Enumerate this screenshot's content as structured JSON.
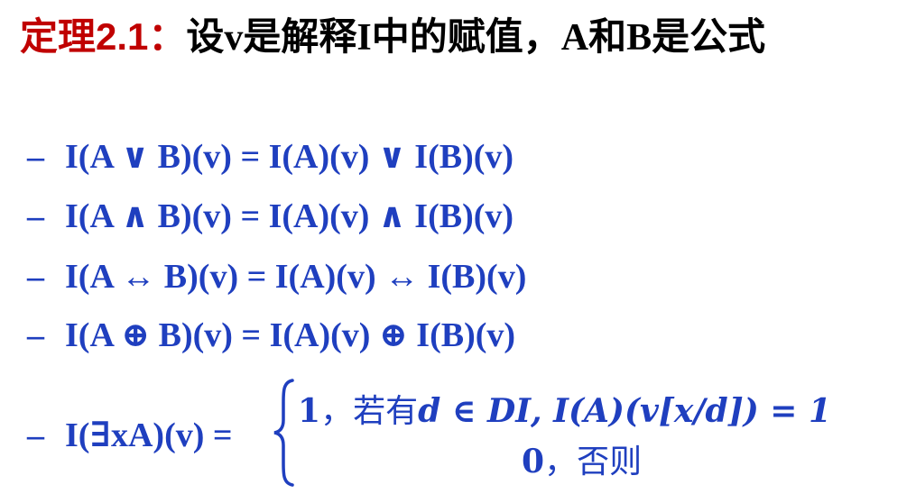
{
  "theorem": {
    "label": "定理2.1：",
    "statement": "设v是解释I中的赋值，A和B是公式"
  },
  "bullet_dash": "–",
  "rules": [
    "I(A ∨ B)(v) = I(A)(v) ∨ I(B)(v)",
    "I(A ∧ B)(v) = I(A)(v) ∧ I(B)(v)",
    "I(A ↔ B)(v) = I(A)(v) ↔ I(B)(v)",
    "I(A ⊕ B)(v) = I(A)(v) ⊕ I(B)(v)"
  ],
  "exists_rule": {
    "lhs": "I(∃xA)(v) =",
    "case1_value": "1",
    "case1_sep": "，",
    "case1_word": "若有",
    "case1_condition": "d ∈ DI, I(A)(v[x/d]) = 1",
    "case2_value": "0",
    "case2_sep": "，",
    "case2_word": "否则"
  },
  "colors": {
    "label": "#c00000",
    "body": "#000000",
    "formula": "#1f3fbf"
  }
}
